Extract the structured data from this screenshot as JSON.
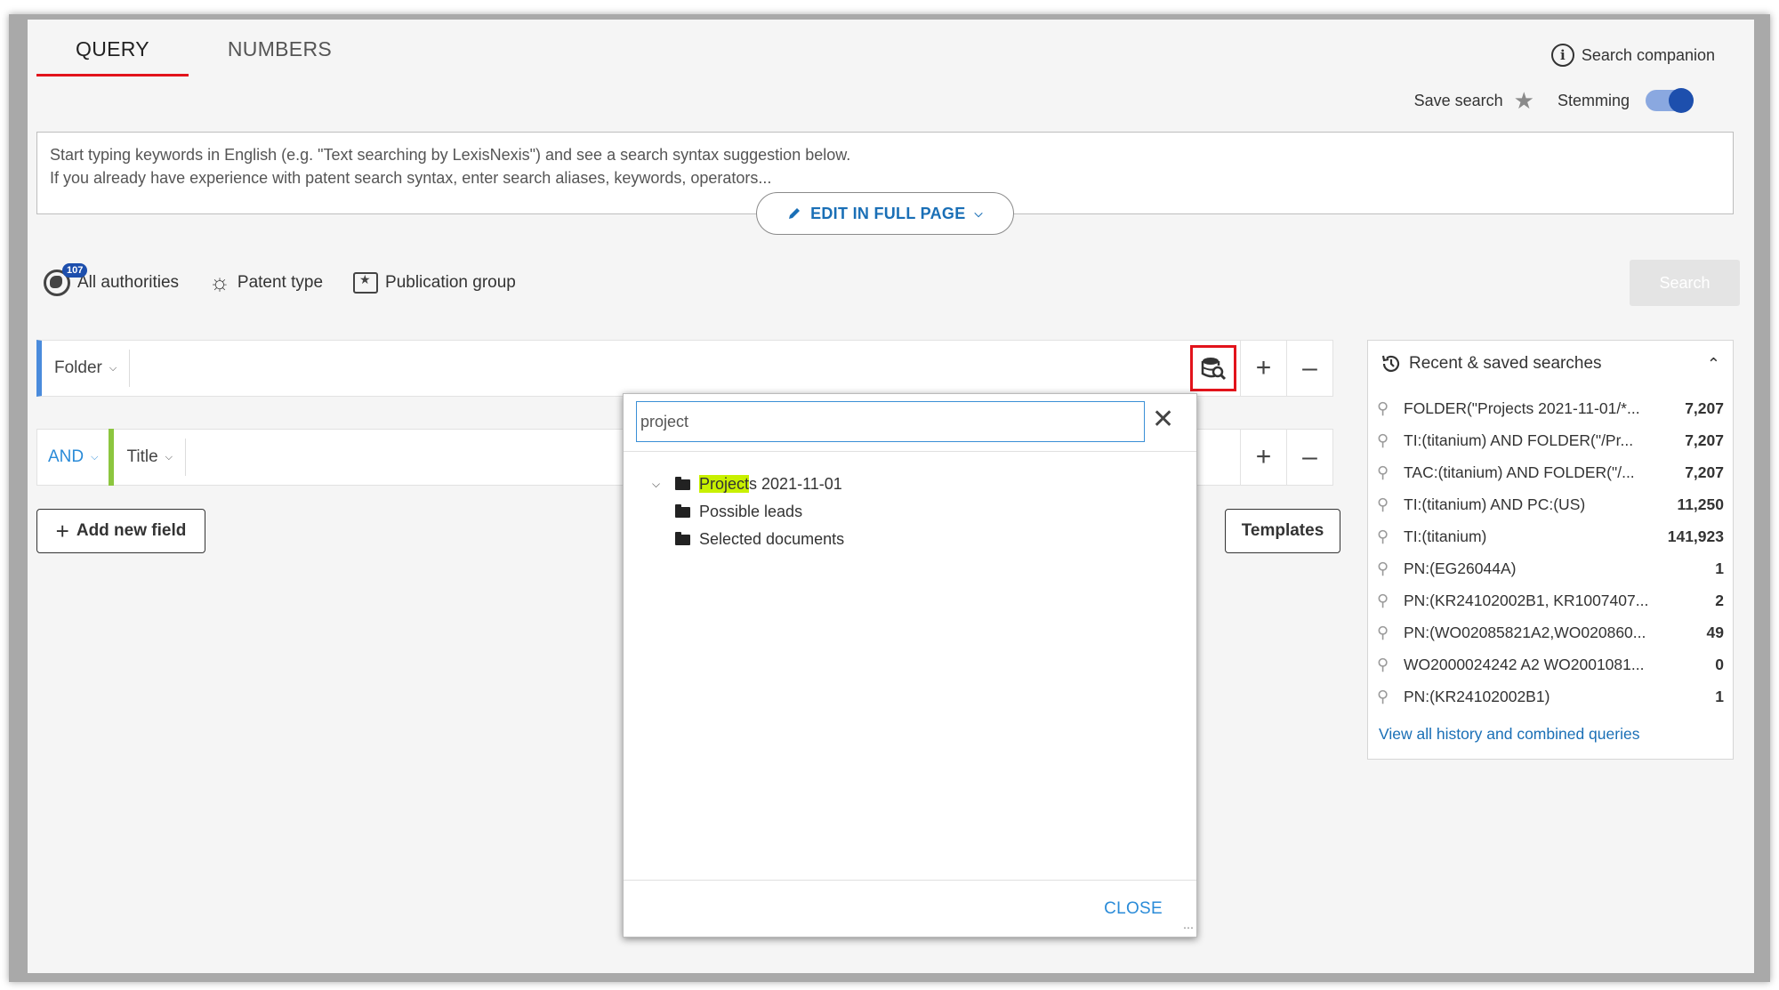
{
  "tabs": [
    {
      "label": "QUERY",
      "active": true
    },
    {
      "label": "NUMBERS",
      "active": false
    }
  ],
  "header": {
    "companion_label": "Search companion",
    "save_search_label": "Save search",
    "stemming_label": "Stemming",
    "stemming_on": true
  },
  "query": {
    "placeholder_line1": "Start typing keywords in English (e.g. \"Text searching by LexisNexis\") and see a search syntax suggestion below.",
    "placeholder_line2": "If you already have experience with patent search syntax, enter search aliases, keywords, operators...",
    "edit_full_page_label": "EDIT IN FULL PAGE"
  },
  "filters": {
    "authorities_count": "107",
    "authorities_label": "All authorities",
    "patent_type_label": "Patent type",
    "publication_group_label": "Publication group"
  },
  "search_button_label": "Search",
  "rows": {
    "row1_field": "Folder",
    "row2_operator": "AND",
    "row2_field": "Title"
  },
  "add_field_label": "Add new field",
  "templates_label": "Templates",
  "folder_popup": {
    "search_value": "project",
    "tree": {
      "root_highlight": "Project",
      "root_rest": "s 2021-11-01",
      "children": [
        "Possible leads",
        "Selected documents"
      ]
    },
    "close_label": "CLOSE"
  },
  "recent": {
    "title": "Recent & saved searches",
    "items": [
      {
        "query": "FOLDER(\"Projects 2021-11-01/*...",
        "count": "7,207"
      },
      {
        "query": "TI:(titanium) AND FOLDER(\"/Pr...",
        "count": "7,207"
      },
      {
        "query": "TAC:(titanium) AND FOLDER(\"/...",
        "count": "7,207"
      },
      {
        "query": "TI:(titanium) AND PC:(US)",
        "count": "11,250"
      },
      {
        "query": "TI:(titanium)",
        "count": "141,923"
      },
      {
        "query": "PN:(EG26044A)",
        "count": "1"
      },
      {
        "query": "PN:(KR24102002B1, KR1007407...",
        "count": "2"
      },
      {
        "query": "PN:(WO02085821A2,WO020860...",
        "count": "49"
      },
      {
        "query": "WO2000024242 A2 WO2001081...",
        "count": "0"
      },
      {
        "query": "PN:(KR24102002B1)",
        "count": "1"
      }
    ],
    "view_all_label": "View all history and combined queries"
  }
}
